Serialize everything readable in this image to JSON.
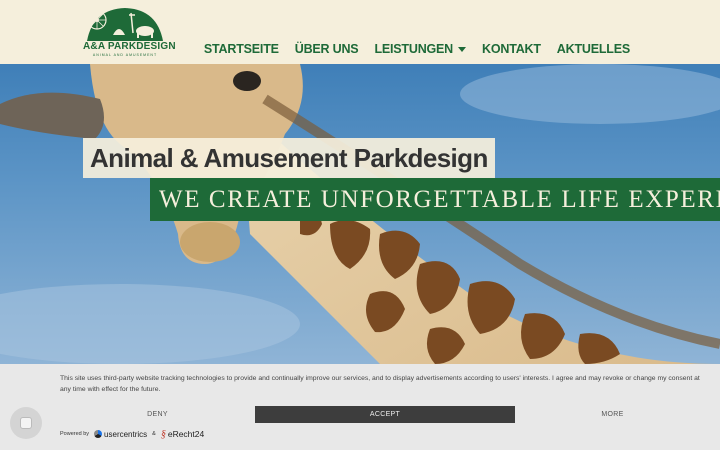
{
  "header": {
    "logo_text": "A&A PARKDESIGN",
    "logo_sub": "ANIMAL AND AMUSEMENT",
    "nav": [
      {
        "label": "STARTSEITE"
      },
      {
        "label": "ÜBER UNS"
      },
      {
        "label": "LEISTUNGEN"
      },
      {
        "label": "KONTAKT"
      },
      {
        "label": "AKTUELLES"
      }
    ]
  },
  "hero": {
    "title": "Animal & Amusement Parkdesign",
    "subtitle": "WE CREATE UNFORGETTABLE LIFE EXPERIENCES"
  },
  "cookie": {
    "text": "This site uses third-party website tracking technologies to provide and continually improve our services, and to display advertisements according to users' interests. I agree and may revoke or change my consent at any time with effect for the future.",
    "deny": "DENY",
    "accept": "ACCEPT",
    "more": "MORE",
    "powered_by": "Powered by",
    "usercentrics": "usercentrics",
    "and": "&",
    "erecht": "eRecht24"
  },
  "colors": {
    "brand_green": "#1e6a38",
    "cream": "#f5efdc",
    "accept_bg": "#3d3d3d"
  }
}
